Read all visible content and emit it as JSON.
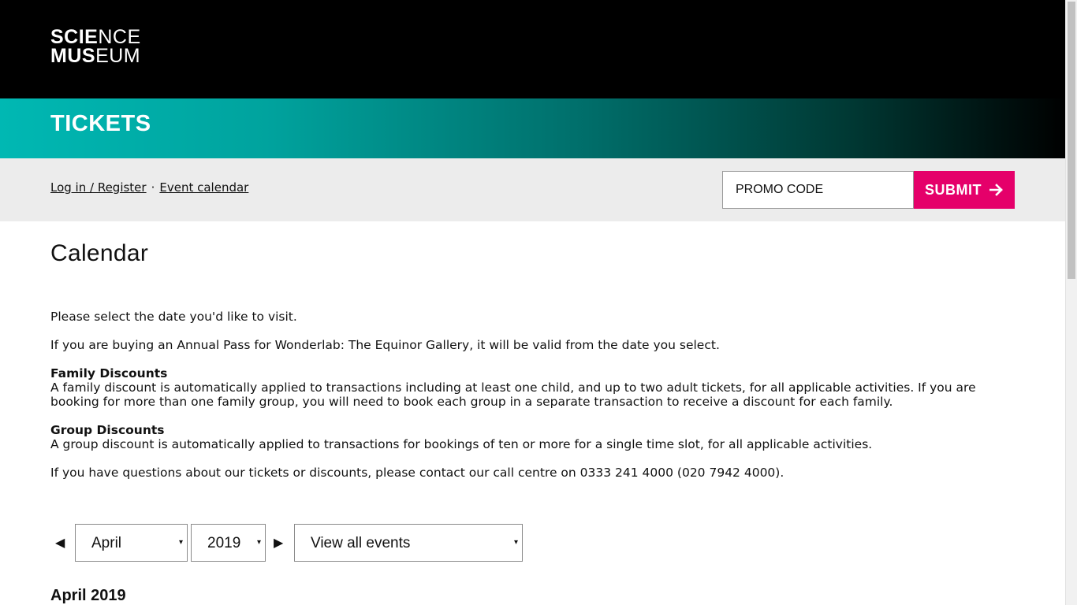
{
  "header": {
    "logo_line1_bold": "SCIE",
    "logo_line1_thin": "NCE",
    "logo_line2_bold": "MUS",
    "logo_line2_thin": "EUM"
  },
  "banner": {
    "title": "TICKETS"
  },
  "subnav": {
    "login_label": "Log in / Register",
    "separator": "·",
    "calendar_label": "Event calendar"
  },
  "promo": {
    "placeholder": "PROMO CODE",
    "value": "",
    "submit_label": "SUBMIT",
    "submit_icon": "arrow-right-icon",
    "submit_color": "#e5006a"
  },
  "page": {
    "title": "Calendar",
    "intro": "Please select the date you'd like to visit.",
    "annual_pass_note": "If you are buying an Annual Pass for Wonderlab: The Equinor Gallery, it will be valid from the date you select.",
    "family_heading": "Family Discounts",
    "family_text": "A family discount is automatically applied to transactions including at least one child, and up to two adult tickets, for all applicable activities. If you are booking for more than one family group, you will need to book each group in a separate transaction to receive a discount for each family.",
    "group_heading": "Group Discounts",
    "group_text": "A group discount is automatically applied to transactions for bookings of ten or more for a single time slot, for all applicable activities.",
    "contact_text": "If you have questions about our tickets or discounts, please contact our call centre on 0333 241 4000 (020 7942 4000)."
  },
  "calendar_controls": {
    "prev_icon": "◀",
    "next_icon": "▶",
    "month_value": "April",
    "year_value": "2019",
    "filter_value": "View all events",
    "caret": "▾"
  },
  "month_heading": "April 2019",
  "colors": {
    "header_bg": "#000000",
    "banner_start": "#00b8b3",
    "banner_end": "#000000",
    "subbar_bg": "#ececec"
  }
}
